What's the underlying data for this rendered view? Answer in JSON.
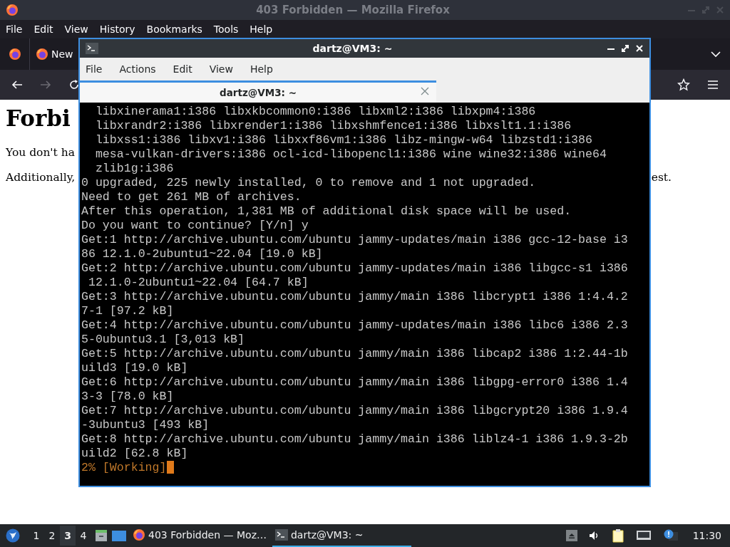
{
  "browser": {
    "title": "403 Forbidden — Mozilla Firefox",
    "menu": [
      "File",
      "Edit",
      "View",
      "History",
      "Bookmarks",
      "Tools",
      "Help"
    ],
    "tab": {
      "label": "New"
    },
    "nav": {
      "forward_disabled": true
    },
    "page": {
      "heading": "Forbi",
      "paragraphs": [
        "You don't ha",
        "Additionally,"
      ],
      "right_fragment": "est."
    }
  },
  "terminal": {
    "title": "dartz@VM3: ~",
    "menu": [
      "File",
      "Actions",
      "Edit",
      "View",
      "Help"
    ],
    "tabs": [
      {
        "label": "dartz@VM3: ~",
        "selected": true
      }
    ],
    "lines": [
      "  libxinerama1:i386 libxkbcommon0:i386 libxml2:i386 libxpm4:i386",
      "  libxrandr2:i386 libxrender1:i386 libxshmfence1:i386 libxslt1.1:i386",
      "  libxss1:i386 libxv1:i386 libxxf86vm1:i386 libz-mingw-w64 libzstd1:i386",
      "  mesa-vulkan-drivers:i386 ocl-icd-libopencl1:i386 wine wine32:i386 wine64",
      "  zlib1g:i386",
      "0 upgraded, 225 newly installed, 0 to remove and 1 not upgraded.",
      "Need to get 261 MB of archives.",
      "After this operation, 1,381 MB of additional disk space will be used.",
      "Do you want to continue? [Y/n] y",
      "Get:1 http://archive.ubuntu.com/ubuntu jammy-updates/main i386 gcc-12-base i3",
      "86 12.1.0-2ubuntu1~22.04 [19.0 kB]",
      "Get:2 http://archive.ubuntu.com/ubuntu jammy-updates/main i386 libgcc-s1 i386",
      " 12.1.0-2ubuntu1~22.04 [64.7 kB]",
      "Get:3 http://archive.ubuntu.com/ubuntu jammy/main i386 libcrypt1 i386 1:4.4.2",
      "7-1 [97.2 kB]",
      "Get:4 http://archive.ubuntu.com/ubuntu jammy-updates/main i386 libc6 i386 2.3",
      "5-0ubuntu3.1 [3,013 kB]",
      "Get:5 http://archive.ubuntu.com/ubuntu jammy/main i386 libcap2 i386 1:2.44-1b",
      "uild3 [19.0 kB]",
      "Get:6 http://archive.ubuntu.com/ubuntu jammy/main i386 libgpg-error0 i386 1.4",
      "3-3 [78.0 kB]",
      "Get:7 http://archive.ubuntu.com/ubuntu jammy/main i386 libgcrypt20 i386 1.9.4",
      "-3ubuntu3 [493 kB]",
      "Get:8 http://archive.ubuntu.com/ubuntu jammy/main i386 liblz4-1 i386 1.9.3-2b",
      "uild2 [62.8 kB]"
    ],
    "status_line": "2% [Working]"
  },
  "taskbar": {
    "workspaces": [
      {
        "label": "1",
        "selected": false
      },
      {
        "label": "2",
        "selected": false
      },
      {
        "label": "3",
        "selected": true
      },
      {
        "label": "4",
        "selected": false
      }
    ],
    "tasks": [
      {
        "kind": "browser",
        "label": "403 Forbidden — Moz…",
        "selected": false
      },
      {
        "kind": "terminal",
        "label": "dartz@VM3: ~",
        "selected": true
      }
    ],
    "clock": "11:30"
  }
}
